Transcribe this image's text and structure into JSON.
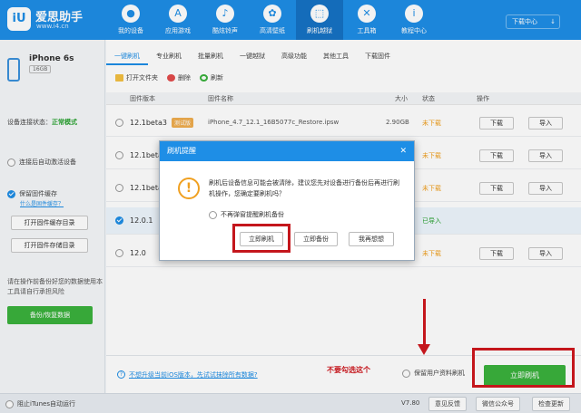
{
  "header": {
    "logo_mark": "iU",
    "logo_name": "爱思助手",
    "logo_url": "www.i4.cn",
    "nav": [
      {
        "label": "我的设备",
        "icon": ""
      },
      {
        "label": "应用游戏",
        "icon": "A"
      },
      {
        "label": "酷炫铃声",
        "icon": "♪"
      },
      {
        "label": "高清壁纸",
        "icon": "✿"
      },
      {
        "label": "刷机越狱",
        "icon": "⬚"
      },
      {
        "label": "工具箱",
        "icon": "✕"
      },
      {
        "label": "教程中心",
        "icon": "i"
      }
    ],
    "download_center": "下载中心",
    "download_arrow": "↓"
  },
  "left": {
    "device_name": "iPhone 6s",
    "capacity": "16GB",
    "conn_label": "设备连接状态：",
    "conn_value": "正常模式",
    "auto_activate": "连接后自动激活设备",
    "keep_cache": "保留固件缓存",
    "what_cache": "什么是固件缓存？",
    "open_cache_dir": "打开固件缓存目录",
    "open_store_dir": "打开固件存储目录",
    "warn_note": "请在操作前备份好您的数据使用本工具请自行承担风险",
    "backup_btn": "备份/恢复数据"
  },
  "main": {
    "tabs": [
      "一键刷机",
      "专业刷机",
      "批量刷机",
      "一键越狱",
      "高级功能",
      "其他工具",
      "下载固件"
    ],
    "toolbar": {
      "open_folder": "打开文件夹",
      "delete": "删除",
      "refresh": "刷新"
    },
    "columns": {
      "version": "固件版本",
      "name": "固件名称",
      "size": "大小",
      "status": "状态",
      "action": "操作"
    },
    "rows": [
      {
        "version": "12.1beta3",
        "tag": "测试版",
        "name": "iPhone_4.7_12.1_16B5077c_Restore.ipsw",
        "size": "2.90GB",
        "status": "未下载",
        "btn1": "下载",
        "btn2": "导入"
      },
      {
        "version": "12.1beta",
        "tag": "",
        "name": "",
        "size": "",
        "status": "未下载",
        "btn1": "下载",
        "btn2": "导入"
      },
      {
        "version": "12.1beta",
        "tag": "",
        "name": "",
        "size": "",
        "status": "未下载",
        "btn1": "下载",
        "btn2": "导入"
      },
      {
        "version": "12.0.1",
        "tag": "",
        "name": "",
        "size": "",
        "status": "已导入",
        "btn1": "",
        "btn2": ""
      },
      {
        "version": "12.0",
        "tag": "",
        "name": "",
        "size": "",
        "status": "未下载",
        "btn1": "下载",
        "btn2": "导入"
      }
    ],
    "info_icon": "?",
    "info_link": "不想升级当前iOS版本，先试试抹除所有数据?",
    "keep_data": "保留用户资料刷机",
    "flash_now": "立即刷机"
  },
  "statusbar": {
    "block_itunes": "阻止iTunes自动运行",
    "version": "V7.80",
    "feedback": "意见反馈",
    "wechat": "微信公众号",
    "check_update": "检查更新"
  },
  "dialog": {
    "title": "刷机提醒",
    "close": "✕",
    "warn_icon": "!",
    "message": "刷机后设备信息可能会被清除，建议您先对设备进行备份后再进行刷机操作，您确定要刷机吗？",
    "no_remind": "不再弹窗提醒刷机备份",
    "btn_flash": "立即刷机",
    "btn_backup": "立即备份",
    "btn_think": "我再想想"
  },
  "annotation": {
    "text": "不要勾选这个",
    "color": "#c4161c"
  }
}
